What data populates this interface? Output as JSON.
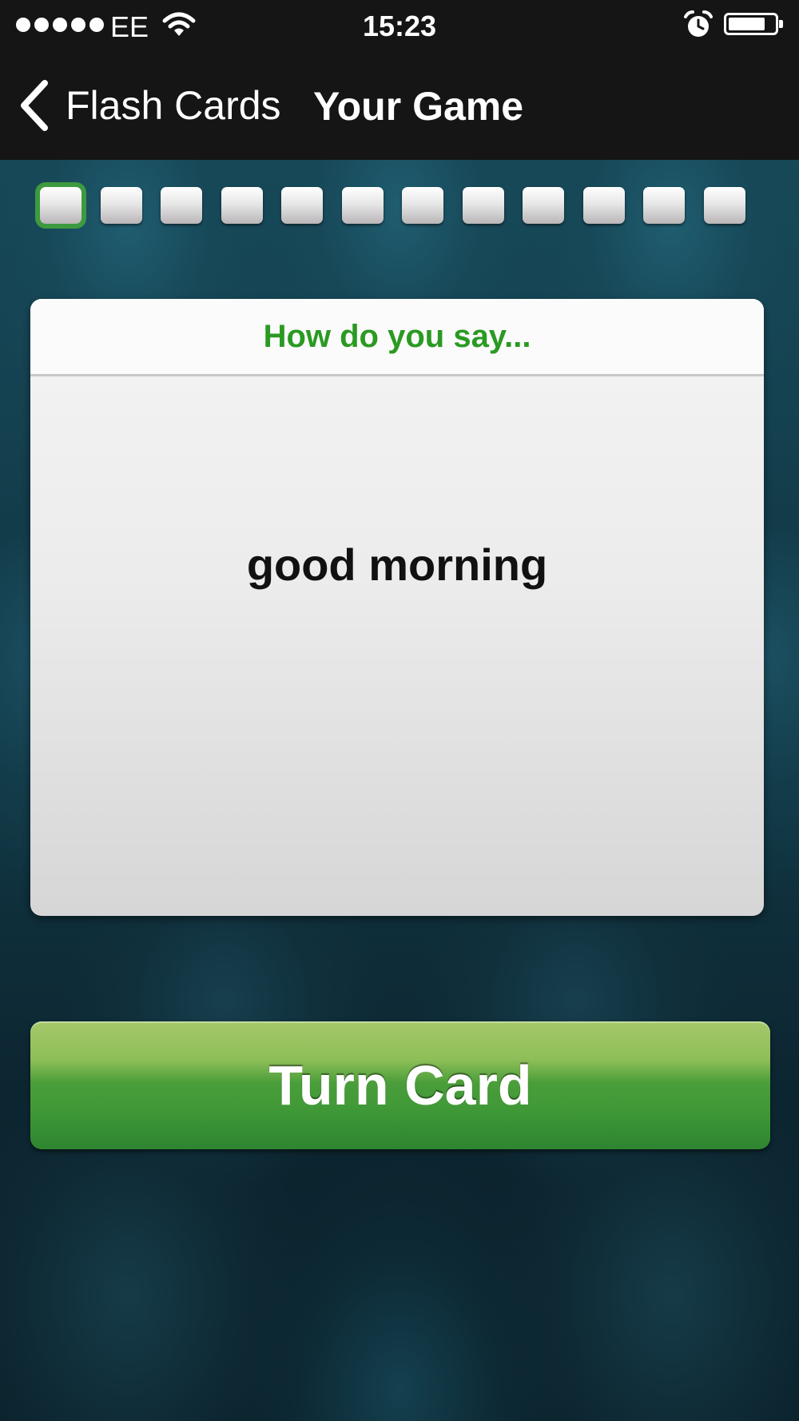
{
  "status_bar": {
    "signal_dots": 5,
    "carrier": "EE",
    "time": "15:23",
    "wifi_icon": "wifi-icon",
    "alarm_icon": "alarm-clock-icon",
    "battery_icon": "battery-icon",
    "battery_level": 0.8
  },
  "nav": {
    "back_label": "Flash Cards",
    "back_icon": "chevron-left-icon",
    "title": "Your Game"
  },
  "progress": {
    "total": 12,
    "current_index": 0,
    "current_color": "#3d9a3f"
  },
  "card": {
    "prompt": "How do you say...",
    "word": "good morning",
    "prompt_color": "#2a9a22"
  },
  "actions": {
    "turn_card_label": "Turn Card",
    "button_color": "#3f9837"
  }
}
